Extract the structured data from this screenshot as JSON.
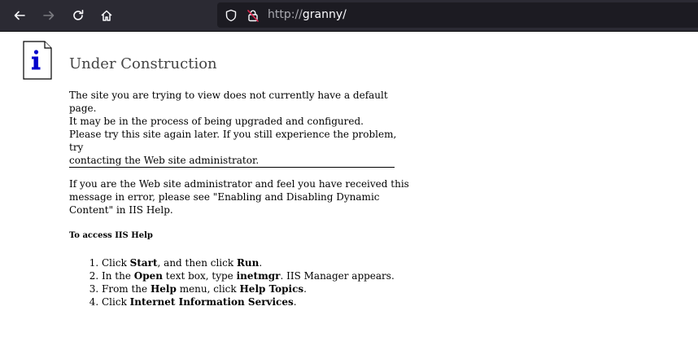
{
  "browser": {
    "url_protocol": "http://",
    "url_host": "granny/"
  },
  "page": {
    "title": "Under Construction",
    "para1_line1": "The site you are trying to view does not currently have a default page.",
    "para1_line2": "It may be in the process of being upgraded and configured.",
    "para2_line1": "Please try this site again later. If you still experience the problem, try",
    "para2_line2": "contacting the Web site administrator.",
    "para3_line1": "If you are the Web site administrator and feel you have received this",
    "para3_line2": "message in error, please see \"Enabling and Disabling Dynamic",
    "para3_line3": "Content\" in IIS Help.",
    "help_heading": "To access IIS Help",
    "steps": [
      {
        "a": "Click ",
        "b1": "Start",
        "c": ", and then click ",
        "b2": "Run",
        "d": "."
      },
      {
        "a": "In the ",
        "b1": "Open",
        "c": " text box, type ",
        "b2": "inetmgr",
        "d": ". IIS Manager appears."
      },
      {
        "a": "From the ",
        "b1": "Help",
        "c": " menu, click ",
        "b2": "Help Topics",
        "d": "."
      },
      {
        "a": "Click ",
        "b1": "Internet Information Services",
        "c": "",
        "b2": "",
        "d": "."
      }
    ]
  }
}
